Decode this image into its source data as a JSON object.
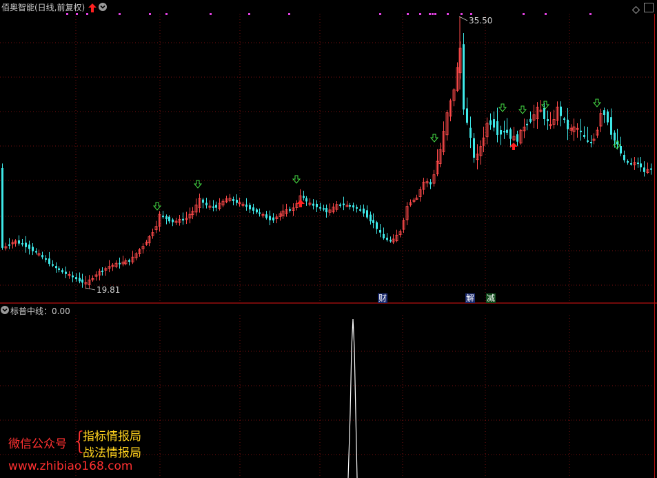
{
  "header": {
    "title": "佰奥智能(日线,前复权)",
    "dropdown_icon": "chevron-down-icon",
    "signal_icon": "red-up-arrow-icon",
    "diamond_icon": "diamond-icon",
    "maximize_icon": "maximize-icon"
  },
  "price_chart": {
    "high_label": "35.50",
    "low_label": "19.81",
    "events": [
      {
        "label": "财",
        "bg": "#1a2a6e"
      },
      {
        "label": "解",
        "bg": "#1a2a6e"
      },
      {
        "label": "减",
        "bg": "#0f4a1a"
      }
    ]
  },
  "indicator": {
    "title": "标普中线",
    "sep": "：",
    "value": "0.00"
  },
  "watermark": {
    "left": "微信公众号",
    "brace": "{",
    "line1": "指标情报局",
    "line2": "战法情报局",
    "url": "www.zhibiao168.com"
  },
  "colors": {
    "up": "#ff4a4a",
    "down": "#3ee8e8",
    "grid": "#7a1010",
    "border": "#b81010",
    "signal_dot": "#e040e0",
    "green_arrow": "#46e046",
    "red_arrow": "#ff2020",
    "indicator_line": "#ffffff"
  }
}
